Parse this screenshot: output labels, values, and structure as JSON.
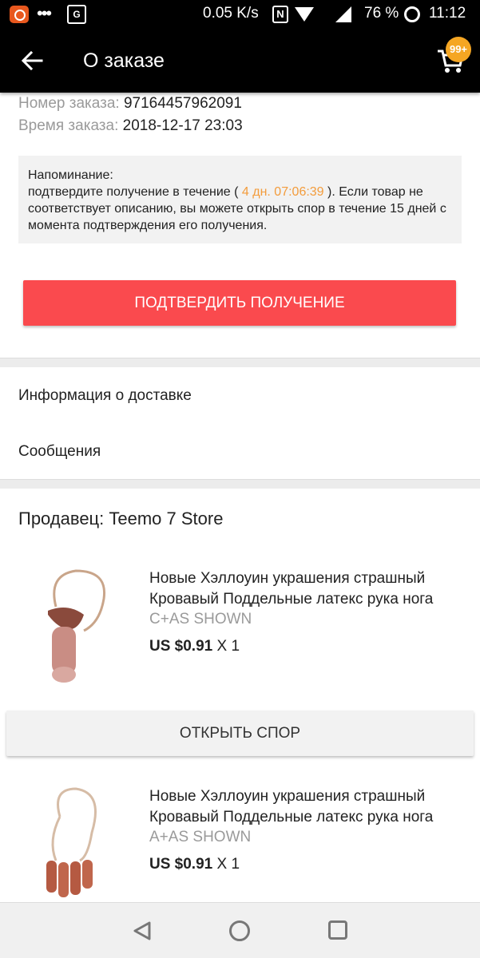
{
  "status_bar": {
    "speed": "0.05 K/s",
    "battery": "76 %",
    "time": "11:12",
    "nfc_label": "N",
    "translate_label": "G"
  },
  "app_bar": {
    "title": "О заказе",
    "cart_badge": "99+"
  },
  "order": {
    "number_label": "Номер заказа:",
    "number_value": "97164457962091",
    "time_label": "Время заказа:",
    "time_value": "2018-12-17 23:03"
  },
  "reminder": {
    "heading": "Напоминание:",
    "text_before": "подтвердите получение в течение (",
    "countdown": "4 дн. 07:06:39",
    "text_after": "). Если товар не соответствует описанию, вы можете открыть спор в течение 15 дней с момента подтверждения его получения.",
    "countdown_color": "#f39c3c"
  },
  "confirm_button": {
    "label": "ПОДТВЕРДИТЬ ПОЛУЧЕНИЕ",
    "color": "#fa4a4e"
  },
  "menu": {
    "delivery": "Информация о доставке",
    "messages": "Сообщения"
  },
  "seller": {
    "label": "Продавец: Teemo 7 Store"
  },
  "products": [
    {
      "title_line1": "Новые Хэллоуин украшения страшный",
      "title_line2": "Кровавый Поддельные латекс рука нога",
      "variant": "C+AS SHOWN",
      "price": "US $0.91",
      "qty": "X 1"
    },
    {
      "title_line1": "Новые Хэллоуин украшения страшный",
      "title_line2": "Кровавый Поддельные латекс рука нога",
      "variant": "A+AS SHOWN",
      "price": "US $0.91",
      "qty": "X 1"
    }
  ],
  "dispute_button": {
    "label": "ОТКРЫТЬ СПОР"
  }
}
